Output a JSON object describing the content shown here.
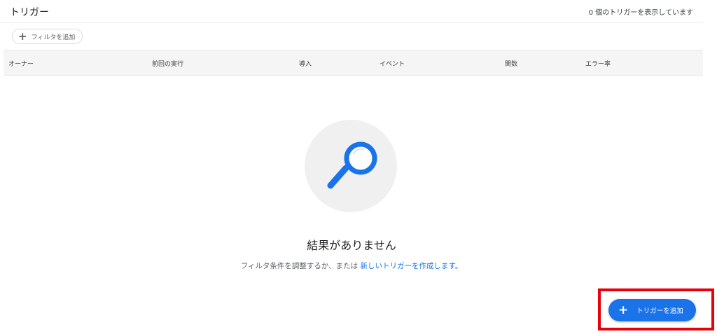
{
  "header": {
    "title": "トリガー",
    "count_text": "0 個のトリガーを表示しています"
  },
  "filter": {
    "add_label": "フィルタを追加",
    "icon": "plus-icon"
  },
  "table": {
    "columns": [
      "オーナー",
      "前回の実行",
      "導入",
      "イベント",
      "関数",
      "エラー率"
    ]
  },
  "empty_state": {
    "icon": "search-icon",
    "title": "結果がありません",
    "description_prefix": "フィルタ条件を調整するか、または ",
    "description_link": "新しいトリガーを作成します。"
  },
  "fab": {
    "label": "トリガーを追加",
    "icon": "plus-icon",
    "color": "#1a73e8"
  },
  "annotation": {
    "highlight_color": "#e8000b"
  }
}
